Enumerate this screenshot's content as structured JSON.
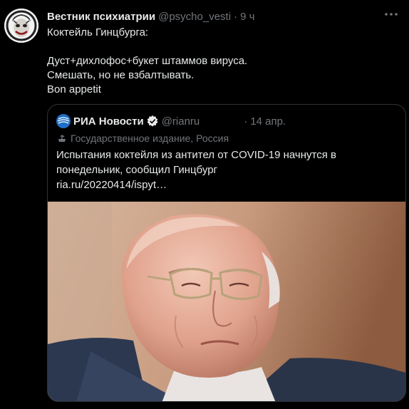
{
  "tweet": {
    "author_name": "Вестник психиатрии",
    "author_handle": "@psycho_vesti",
    "separator": "·",
    "time": "9 ч",
    "text": "Коктейль Гинцбурга:\n\nДуст+дихлофос+букет штаммов вируса.\nСмешать, но не взбалтывать.\n Bon appetit"
  },
  "quote": {
    "author_name": "РИА Новости",
    "author_handle": "@rianru",
    "separator": "·",
    "time": "14 апр.",
    "label": "Государственное издание, Россия",
    "text": "Испытания коктейля из антител от COVID-19 начнутся в понедельник, сообщил Гинцбург\nria.ru/20220414/ispyt…"
  },
  "icons": {
    "more": "more-horizontal-icon",
    "verified": "verified-badge-icon",
    "label": "state-media-icon"
  },
  "colors": {
    "background": "#000000",
    "text": "#e7e9ea",
    "muted": "#71767b",
    "border": "#2f3336",
    "ria_blue": "#1d6fc7"
  }
}
